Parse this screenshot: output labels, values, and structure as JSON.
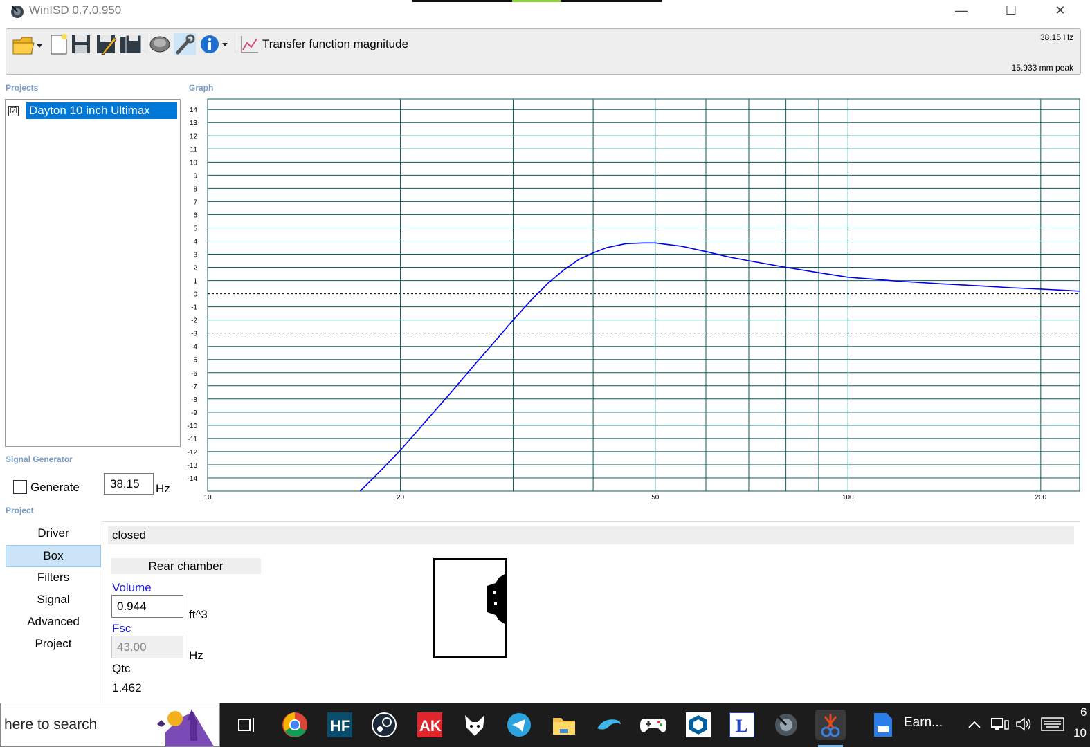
{
  "window": {
    "title": "WinISD 0.7.0.950",
    "minimize_glyph": "—",
    "maximize_glyph": "☐",
    "close_glyph": "✕"
  },
  "toolbar": {
    "icons": [
      "open-folder-icon",
      "new-document-icon",
      "save-icon",
      "save-as-icon",
      "save-all-icon",
      "driver-icon",
      "tools-icon",
      "info-icon",
      "graph-icon"
    ],
    "graph_selector_label": "Transfer function magnitude",
    "cursor_frequency": "38.15 Hz",
    "excursion_readout": "15.933 mm peak"
  },
  "projects": {
    "section_label": "Projects",
    "items": [
      {
        "name": "Dayton 10 inch Ultimax",
        "checked": true
      }
    ]
  },
  "signal_generator": {
    "section_label": "Signal Generator",
    "generate_label": "Generate",
    "generate_checked": false,
    "frequency_value": "38.15",
    "frequency_unit": "Hz"
  },
  "graph": {
    "section_label": "Graph"
  },
  "chart_data": {
    "type": "line",
    "title": "",
    "xlabel": "",
    "ylabel": "",
    "x_scale": "log",
    "xlim": [
      10,
      230
    ],
    "ylim": [
      -15,
      15
    ],
    "x_tick_labels": [
      "10",
      "20",
      "50",
      "100",
      "200"
    ],
    "x_grid": [
      10,
      20,
      30,
      40,
      50,
      60,
      70,
      80,
      90,
      100,
      200
    ],
    "y_ticks": [
      14,
      13,
      12,
      11,
      10,
      9,
      8,
      7,
      6,
      5,
      4,
      3,
      2,
      1,
      0,
      -1,
      -2,
      -3,
      -4,
      -5,
      -6,
      -7,
      -8,
      -9,
      -10,
      -11,
      -12,
      -13,
      -14
    ],
    "reference_lines": [
      0,
      -3
    ],
    "grid": true,
    "series": [
      {
        "color": "#0000ee",
        "x": [
          17.3,
          18.5,
          20,
          22,
          24,
          26,
          28,
          30,
          32,
          34,
          36,
          38,
          40,
          42,
          45,
          48,
          50,
          55,
          60,
          65,
          70,
          80,
          90,
          100,
          120,
          140,
          160,
          180,
          200,
          230
        ],
        "y": [
          -15,
          -13.6,
          -11.9,
          -9.6,
          -7.5,
          -5.5,
          -3.7,
          -2.0,
          -0.5,
          0.8,
          1.8,
          2.6,
          3.1,
          3.5,
          3.8,
          3.85,
          3.85,
          3.6,
          3.2,
          2.8,
          2.5,
          2.0,
          1.6,
          1.25,
          0.95,
          0.75,
          0.6,
          0.45,
          0.35,
          0.2
        ]
      }
    ]
  },
  "project_nav": {
    "section_label": "Project",
    "items": [
      "Driver",
      "Box",
      "Filters",
      "Signal",
      "Advanced",
      "Project"
    ],
    "selected": "Box"
  },
  "box_panel": {
    "box_type": "closed",
    "rear_chamber_header": "Rear chamber",
    "volume_label": "Volume",
    "volume_value": "0.944",
    "volume_unit": "ft^3",
    "fsc_label": "Fsc",
    "fsc_value": "43.00",
    "fsc_unit": "Hz",
    "qtc_label": "Qtc",
    "qtc_value": "1.462"
  },
  "taskbar": {
    "search_text": "here to search",
    "apps": [
      "task-view-icon",
      "chrome-icon",
      "hf-icon",
      "steam-icon",
      "ak-icon",
      "fox-icon",
      "telegram-icon",
      "file-explorer-icon",
      "dolphin-icon",
      "gamepad-icon",
      "sketchup-icon",
      "l-app-icon",
      "winisd-icon",
      "snipping-tool-icon",
      "earnings-app-icon"
    ],
    "active_app": "snipping-tool-icon",
    "earnings_label": "Earn...",
    "clock_partial_top": "6",
    "clock_partial_bottom": "10"
  }
}
